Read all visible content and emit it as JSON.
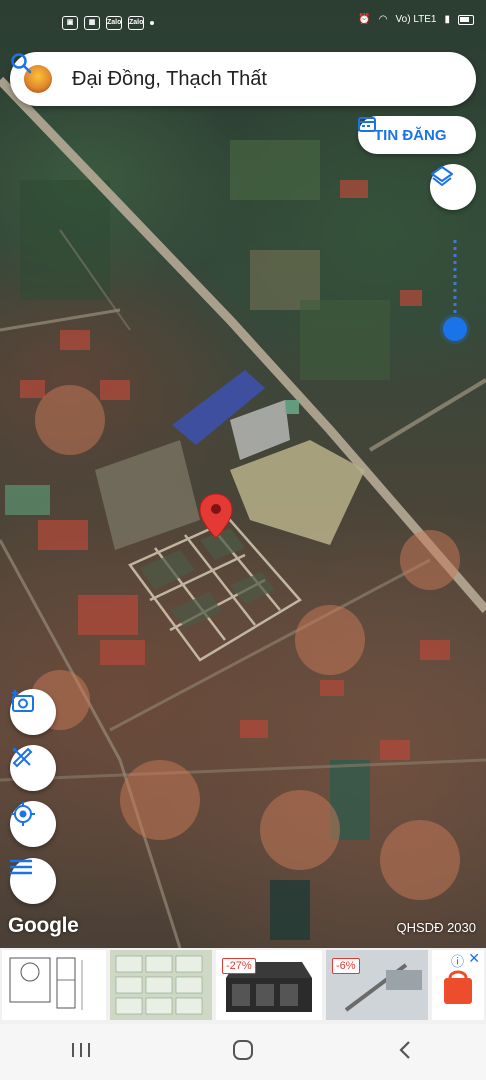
{
  "status_bar": {
    "left_icons": [
      "gallery-icon",
      "screen-icon",
      "zalo-icon",
      "zalo-icon"
    ],
    "zalo_label": "Zalo",
    "network_label": "Vo) LTE1"
  },
  "search": {
    "query": "Đại Đồng, Thạch Thất"
  },
  "tin_dang": {
    "label": "TIN ĐĂNG"
  },
  "map": {
    "google_label": "Google",
    "overlay_label": "QHSDĐ 2030",
    "pin_color": "#e53935",
    "location_dot_color": "#1a73e8"
  },
  "ads": {
    "items": [
      {
        "badge": ""
      },
      {
        "badge": ""
      },
      {
        "badge": "-27%"
      },
      {
        "badge": "-6%"
      }
    ],
    "info_icon": "info-icon",
    "close_icon": "close-icon"
  },
  "nav": {
    "buttons": [
      "recent-apps-icon",
      "home-icon",
      "back-icon"
    ]
  }
}
